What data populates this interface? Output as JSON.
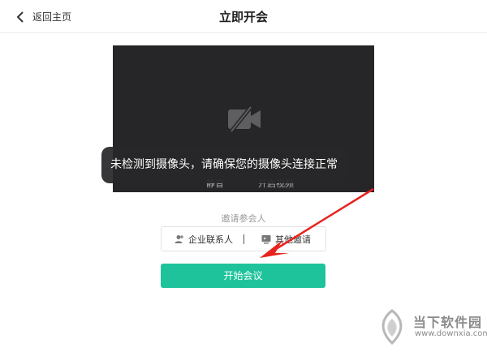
{
  "header": {
    "back_label": "返回主页",
    "title": "立即开会"
  },
  "preview": {
    "camera_icon": "camera-off-icon",
    "controls": {
      "mute_label": "静音",
      "video_label": "开启视频"
    }
  },
  "toast": {
    "message": "未检测到摄像头，请确保您的摄像头连接正常"
  },
  "invite": {
    "title": "邀请参会人",
    "options": [
      {
        "label": "企业联系人",
        "icon": "add-person-icon"
      },
      {
        "label": "其他邀请",
        "icon": "screen-icon"
      }
    ]
  },
  "start_button": {
    "label": "开始会议"
  },
  "watermark": {
    "brand": "当下软件园",
    "url": "www.downxia.com"
  },
  "colors": {
    "primary": "#1ec39b",
    "preview_bg": "#262628",
    "annotation": "#e8231f"
  }
}
